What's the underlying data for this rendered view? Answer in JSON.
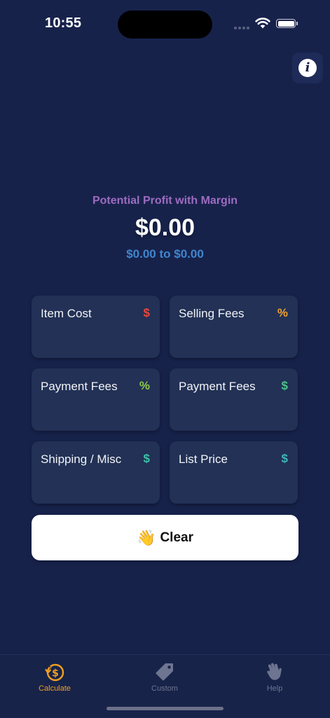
{
  "status_bar": {
    "time": "10:55"
  },
  "header": {
    "info_icon": "info-icon",
    "info_glyph": "i"
  },
  "summary": {
    "label": "Potential Profit with Margin",
    "value": "$0.00",
    "range": "$0.00 to $0.00"
  },
  "fields": [
    {
      "label": "Item Cost",
      "unit": "$",
      "unit_color": "#e8483c"
    },
    {
      "label": "Selling Fees",
      "unit": "%",
      "unit_color": "#f0a030"
    },
    {
      "label": "Payment Fees",
      "unit": "%",
      "unit_color": "#8cc84b"
    },
    {
      "label": "Payment Fees",
      "unit": "$",
      "unit_color": "#4cc38a"
    },
    {
      "label": "Shipping / Misc",
      "unit": "$",
      "unit_color": "#3fc2a8"
    },
    {
      "label": "List Price",
      "unit": "$",
      "unit_color": "#3fb6b8"
    }
  ],
  "clear_button": {
    "emoji": "👋",
    "label": "Clear"
  },
  "tabs": [
    {
      "label": "Calculate",
      "icon": "dollar-refresh-icon",
      "active": true
    },
    {
      "label": "Custom",
      "icon": "tag-icon",
      "active": false
    },
    {
      "label": "Help",
      "icon": "hand-wave-icon",
      "active": false
    }
  ],
  "colors": {
    "background": "#17224b",
    "card": "#223155",
    "summary_label": "#9d6cc0",
    "summary_range": "#3f86cf",
    "tab_active": "#f0a020",
    "tab_inactive": "#6e7590"
  }
}
